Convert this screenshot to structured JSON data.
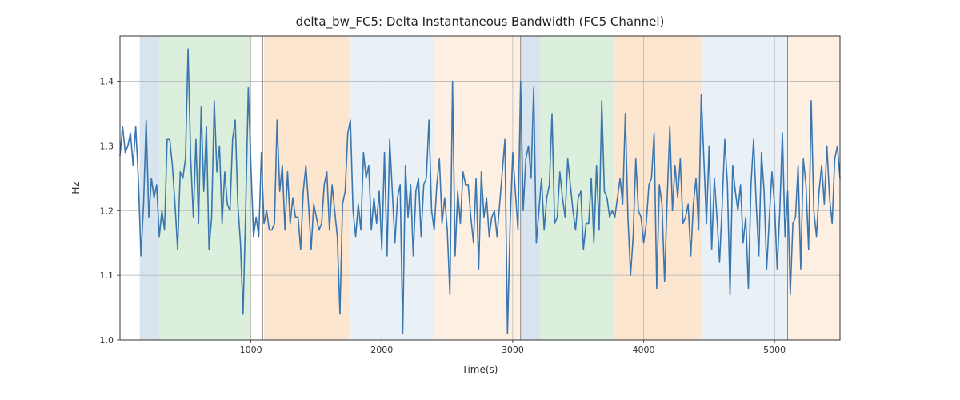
{
  "chart_data": {
    "type": "line",
    "title": "delta_bw_FC5: Delta Instantaneous Bandwidth (FC5 Channel)",
    "xlabel": "Time(s)",
    "ylabel": "Hz",
    "xlim": [
      0,
      5500
    ],
    "ylim": [
      1.0,
      1.47
    ],
    "x_step": 20,
    "xticks": [
      1000,
      2000,
      3000,
      4000,
      5000
    ],
    "yticks": [
      1.0,
      1.1,
      1.2,
      1.3,
      1.4
    ],
    "regions": [
      {
        "start": 150,
        "end": 300,
        "color": "#b8cfe0",
        "opacity": 0.55
      },
      {
        "start": 300,
        "end": 1000,
        "color": "#c0e2c0",
        "opacity": 0.55
      },
      {
        "start": 1100,
        "end": 1750,
        "color": "#f9d2a9",
        "opacity": 0.55
      },
      {
        "start": 1750,
        "end": 2400,
        "color": "#d7e3ef",
        "opacity": 0.55
      },
      {
        "start": 2400,
        "end": 3060,
        "color": "#fbe4cc",
        "opacity": 0.55
      },
      {
        "start": 3060,
        "end": 3210,
        "color": "#b8cfe0",
        "opacity": 0.55
      },
      {
        "start": 3210,
        "end": 3780,
        "color": "#c0e2c0",
        "opacity": 0.55
      },
      {
        "start": 3780,
        "end": 4440,
        "color": "#f9d2a9",
        "opacity": 0.55
      },
      {
        "start": 4440,
        "end": 5100,
        "color": "#d7e3ef",
        "opacity": 0.55
      },
      {
        "start": 5100,
        "end": 5500,
        "color": "#fbe4cc",
        "opacity": 0.55
      }
    ],
    "vlines": [
      1090,
      3060,
      5100
    ],
    "line_color": "#3a76af",
    "series": [
      {
        "name": "delta_bw_FC5",
        "values": [
          1.285,
          1.33,
          1.29,
          1.3,
          1.32,
          1.27,
          1.33,
          1.25,
          1.13,
          1.21,
          1.34,
          1.19,
          1.25,
          1.22,
          1.24,
          1.16,
          1.2,
          1.17,
          1.31,
          1.31,
          1.27,
          1.21,
          1.14,
          1.26,
          1.25,
          1.28,
          1.45,
          1.28,
          1.19,
          1.31,
          1.18,
          1.36,
          1.23,
          1.33,
          1.14,
          1.19,
          1.37,
          1.26,
          1.3,
          1.18,
          1.26,
          1.21,
          1.2,
          1.31,
          1.34,
          1.21,
          1.15,
          1.04,
          1.2,
          1.39,
          1.27,
          1.16,
          1.19,
          1.16,
          1.29,
          1.18,
          1.2,
          1.17,
          1.17,
          1.18,
          1.34,
          1.23,
          1.27,
          1.17,
          1.26,
          1.18,
          1.22,
          1.19,
          1.19,
          1.14,
          1.23,
          1.27,
          1.21,
          1.14,
          1.21,
          1.19,
          1.17,
          1.18,
          1.24,
          1.26,
          1.17,
          1.24,
          1.2,
          1.16,
          1.04,
          1.21,
          1.23,
          1.32,
          1.34,
          1.2,
          1.16,
          1.21,
          1.17,
          1.29,
          1.25,
          1.27,
          1.17,
          1.22,
          1.18,
          1.23,
          1.14,
          1.29,
          1.13,
          1.31,
          1.23,
          1.15,
          1.22,
          1.24,
          1.01,
          1.27,
          1.19,
          1.24,
          1.13,
          1.23,
          1.25,
          1.16,
          1.24,
          1.25,
          1.34,
          1.2,
          1.17,
          1.24,
          1.28,
          1.18,
          1.22,
          1.17,
          1.07,
          1.4,
          1.13,
          1.23,
          1.18,
          1.26,
          1.24,
          1.24,
          1.19,
          1.15,
          1.25,
          1.11,
          1.26,
          1.19,
          1.22,
          1.16,
          1.19,
          1.2,
          1.16,
          1.21,
          1.26,
          1.31,
          1.01,
          1.18,
          1.29,
          1.23,
          1.17,
          1.4,
          1.2,
          1.28,
          1.3,
          1.25,
          1.39,
          1.15,
          1.2,
          1.25,
          1.17,
          1.22,
          1.24,
          1.35,
          1.18,
          1.19,
          1.26,
          1.22,
          1.19,
          1.28,
          1.24,
          1.2,
          1.17,
          1.22,
          1.23,
          1.14,
          1.18,
          1.18,
          1.25,
          1.15,
          1.27,
          1.17,
          1.37,
          1.23,
          1.22,
          1.19,
          1.2,
          1.19,
          1.22,
          1.25,
          1.21,
          1.35,
          1.19,
          1.1,
          1.16,
          1.28,
          1.2,
          1.19,
          1.15,
          1.18,
          1.24,
          1.25,
          1.32,
          1.08,
          1.24,
          1.21,
          1.09,
          1.22,
          1.33,
          1.2,
          1.27,
          1.22,
          1.28,
          1.18,
          1.19,
          1.21,
          1.13,
          1.21,
          1.25,
          1.17,
          1.38,
          1.28,
          1.18,
          1.3,
          1.14,
          1.25,
          1.19,
          1.12,
          1.21,
          1.31,
          1.24,
          1.07,
          1.27,
          1.23,
          1.2,
          1.24,
          1.15,
          1.19,
          1.08,
          1.24,
          1.31,
          1.21,
          1.13,
          1.29,
          1.23,
          1.11,
          1.19,
          1.26,
          1.21,
          1.11,
          1.2,
          1.32,
          1.16,
          1.23,
          1.07,
          1.18,
          1.19,
          1.27,
          1.11,
          1.28,
          1.24,
          1.14,
          1.37,
          1.2,
          1.16,
          1.23,
          1.27,
          1.21,
          1.3,
          1.22,
          1.18,
          1.28,
          1.3,
          1.25
        ]
      }
    ]
  }
}
